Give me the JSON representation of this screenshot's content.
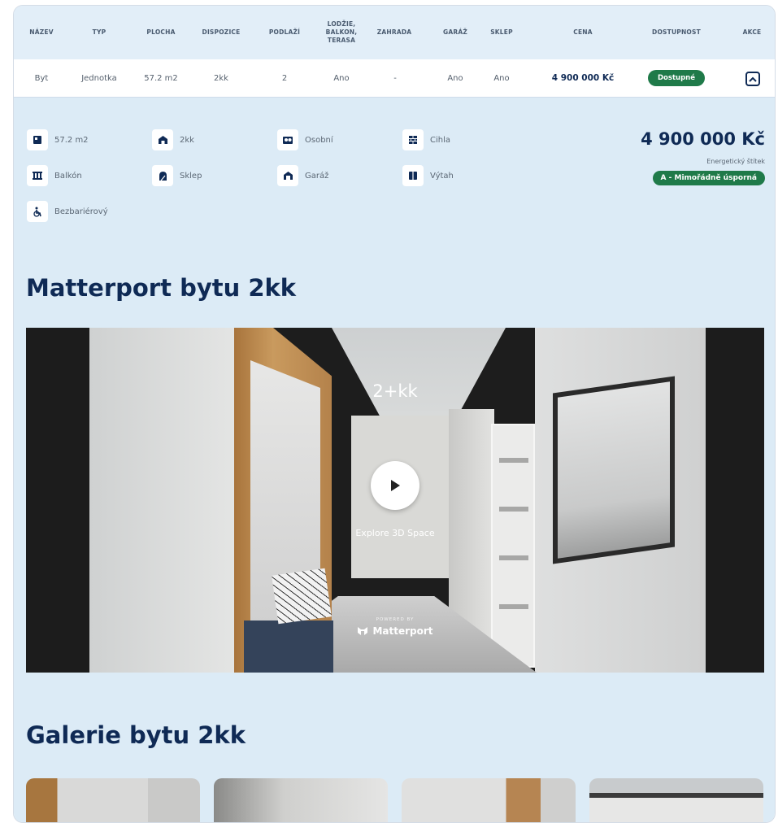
{
  "table": {
    "headers": [
      "NÁZEV",
      "TYP",
      "PLOCHA",
      "DISPOZICE",
      "PODLAŽÍ",
      "LODŽIE, BALKON, TERASA",
      "ZAHRADA",
      "GARÁŽ",
      "SKLEP",
      "CENA",
      "DOSTUPNOST",
      "AKCE"
    ],
    "row": {
      "name": "Byt",
      "type": "Jednotka",
      "area": "57.2 m2",
      "layout": "2kk",
      "floor": "2",
      "balcony": "Ano",
      "garden": "-",
      "garage": "Ano",
      "cellar": "Ano",
      "price": "4 900 000 Kč",
      "availability": "Dostupné"
    }
  },
  "features": [
    {
      "icon": "floor-plan-icon",
      "label": "57.2 m2"
    },
    {
      "icon": "layout-icon",
      "label": "2kk"
    },
    {
      "icon": "ownership-icon",
      "label": "Osobní"
    },
    {
      "icon": "brick-icon",
      "label": "Cihla"
    },
    {
      "icon": "balcony-icon",
      "label": "Balkón"
    },
    {
      "icon": "cellar-icon",
      "label": "Sklep"
    },
    {
      "icon": "garage-icon",
      "label": "Garáž"
    },
    {
      "icon": "elevator-icon",
      "label": "Výtah"
    },
    {
      "icon": "wheelchair-icon",
      "label": "Bezbariérový"
    }
  ],
  "summary": {
    "price": "4 900 000 Kč",
    "energy_label": "Energetický štítek",
    "energy_value": "A - Mimořádně úsporná"
  },
  "matterport": {
    "title": "Matterport bytu 2kk",
    "viewer_title": "2+kk",
    "explore": "Explore 3D Space",
    "powered": "POWERED BY",
    "brand": "Matterport"
  },
  "gallery": {
    "title": "Galerie bytu 2kk"
  },
  "colors": {
    "accent": "#0f2a55",
    "success": "#1f7a49",
    "panel": "#dcebf6"
  }
}
